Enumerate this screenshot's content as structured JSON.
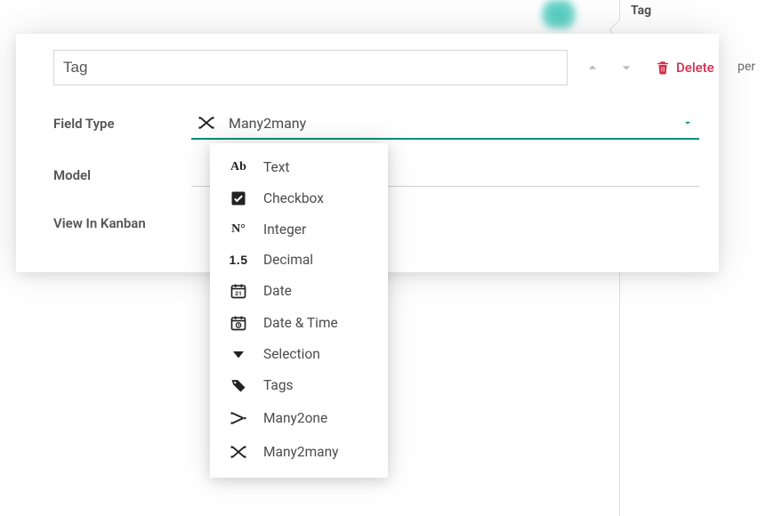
{
  "right_panel": {
    "title": "Tag",
    "per": "per"
  },
  "card": {
    "tag_value": "Tag",
    "delete_label": "Delete",
    "labels": {
      "field_type": "Field Type",
      "model": "Model",
      "view_in_kanban": "View In Kanban"
    },
    "field_type_selected": "Many2many",
    "field_type_selected_icon": "many2many-icon",
    "field_type_options": [
      {
        "icon": "text-icon",
        "label": "Text"
      },
      {
        "icon": "checkbox-icon",
        "label": "Checkbox"
      },
      {
        "icon": "integer-icon",
        "label": "Integer"
      },
      {
        "icon": "decimal-icon",
        "label": "Decimal"
      },
      {
        "icon": "date-icon",
        "label": "Date"
      },
      {
        "icon": "datetime-icon",
        "label": "Date & Time"
      },
      {
        "icon": "selection-icon",
        "label": "Selection"
      },
      {
        "icon": "tags-icon",
        "label": "Tags"
      },
      {
        "icon": "many2one-icon",
        "label": "Many2one"
      },
      {
        "icon": "many2many-icon",
        "label": "Many2many"
      }
    ]
  },
  "colors": {
    "accent": "#008f7a",
    "danger": "#d22f4f"
  }
}
